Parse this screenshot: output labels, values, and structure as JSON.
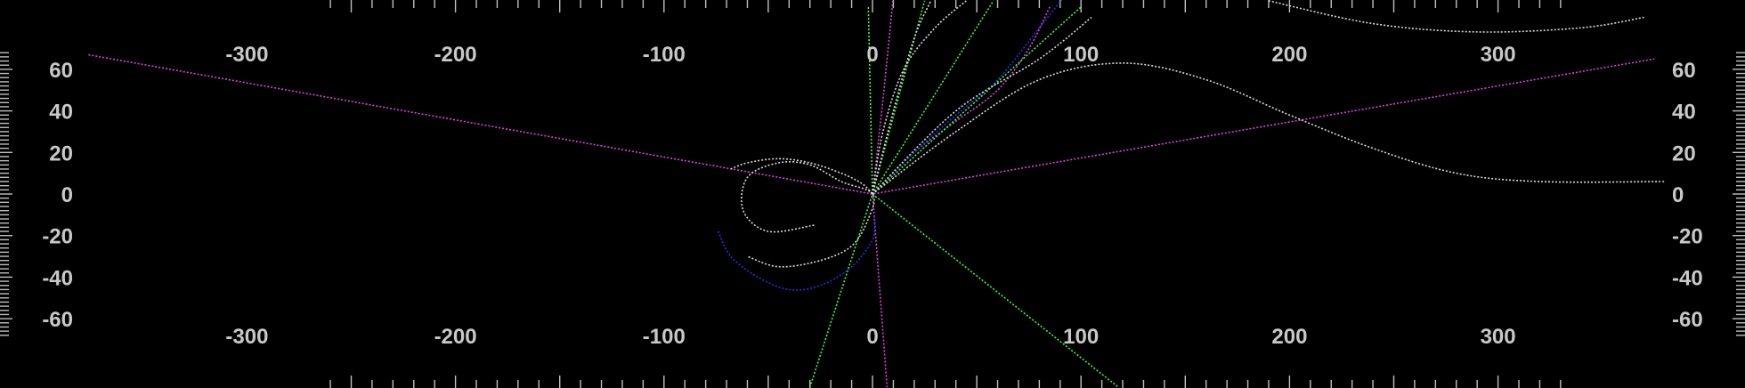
{
  "chart_data": {
    "type": "line",
    "title": "",
    "xlabel": "",
    "ylabel": "",
    "xlim": [
      -420,
      420
    ],
    "ylim": [
      -93,
      93
    ],
    "grid": false,
    "x_ticks": [
      {
        "value": -300,
        "label": "-300"
      },
      {
        "value": -200,
        "label": "-200"
      },
      {
        "value": -100,
        "label": "-100"
      },
      {
        "value": 0,
        "label": "0"
      },
      {
        "value": 100,
        "label": "100"
      },
      {
        "value": 200,
        "label": "200"
      },
      {
        "value": 300,
        "label": "300"
      }
    ],
    "y_ticks": [
      {
        "value": 60,
        "label": "60"
      },
      {
        "value": 40,
        "label": "40"
      },
      {
        "value": 20,
        "label": "20"
      },
      {
        "value": 0,
        "label": "0"
      },
      {
        "value": -20,
        "label": "-20"
      },
      {
        "value": -40,
        "label": "-40"
      },
      {
        "value": -60,
        "label": "-60"
      }
    ],
    "minor_tick_step_x": 10,
    "minor_tick_step_y": 2,
    "colors": {
      "background": "#000000",
      "axis_text": "#c8c8c8",
      "white": "#d8d8d8",
      "green": "#33ff33",
      "magenta": "#e040e0",
      "blue": "#2233dd"
    },
    "series": [
      {
        "color": "magenta",
        "points": [
          [
            -376,
            67
          ],
          [
            0,
            0
          ],
          [
            375,
            65
          ]
        ]
      },
      {
        "color": "magenta",
        "points": [
          [
            0,
            0
          ],
          [
            5,
            45
          ],
          [
            10,
            95
          ]
        ]
      },
      {
        "color": "magenta",
        "points": [
          [
            0,
            0
          ],
          [
            7,
            -93
          ]
        ]
      },
      {
        "color": "magenta",
        "points": [
          [
            0,
            0
          ],
          [
            20,
            20
          ],
          [
            40,
            35
          ],
          [
            60,
            50
          ],
          [
            75,
            70
          ],
          [
            85,
            90
          ]
        ]
      },
      {
        "color": "green",
        "points": [
          [
            -30,
            -93
          ],
          [
            0,
            0
          ],
          [
            25,
            93
          ]
        ]
      },
      {
        "color": "green",
        "points": [
          [
            0,
            0
          ],
          [
            58,
            93
          ]
        ]
      },
      {
        "color": "green",
        "points": [
          [
            0,
            0
          ],
          [
            100,
            90
          ]
        ]
      },
      {
        "color": "green",
        "points": [
          [
            0,
            0
          ],
          [
            118,
            -93
          ]
        ]
      },
      {
        "color": "green",
        "points": [
          [
            0,
            0
          ],
          [
            -2,
            90
          ]
        ]
      },
      {
        "color": "blue",
        "points": [
          [
            0,
            0
          ],
          [
            20,
            20
          ],
          [
            40,
            38
          ],
          [
            60,
            55
          ],
          [
            80,
            80
          ],
          [
            92,
            95
          ]
        ]
      },
      {
        "color": "blue",
        "points": [
          [
            -74,
            -18
          ],
          [
            -68,
            -30
          ],
          [
            -55,
            -40
          ],
          [
            -40,
            -46
          ],
          [
            -25,
            -44
          ],
          [
            -10,
            -35
          ],
          [
            0,
            -22
          ],
          [
            1,
            -10
          ]
        ]
      },
      {
        "color": "white",
        "points": [
          [
            -68,
            12
          ],
          [
            -60,
            15
          ],
          [
            -45,
            17
          ],
          [
            -30,
            15
          ],
          [
            -15,
            10
          ],
          [
            -5,
            5
          ],
          [
            0,
            0
          ]
        ]
      },
      {
        "color": "white",
        "points": [
          [
            -28,
            -15
          ],
          [
            -50,
            -18
          ],
          [
            -62,
            -8
          ],
          [
            -60,
            8
          ],
          [
            -45,
            15
          ],
          [
            -30,
            14
          ],
          [
            -15,
            6
          ],
          [
            0,
            0
          ],
          [
            -2,
            -12
          ],
          [
            -10,
            -25
          ],
          [
            -25,
            -32
          ],
          [
            -45,
            -35
          ],
          [
            -60,
            -30
          ]
        ]
      },
      {
        "color": "white",
        "points": [
          [
            0,
            0
          ],
          [
            40,
            30
          ],
          [
            80,
            55
          ],
          [
            120,
            63
          ],
          [
            160,
            55
          ],
          [
            200,
            38
          ],
          [
            240,
            22
          ],
          [
            280,
            10
          ],
          [
            320,
            6
          ],
          [
            380,
            6
          ]
        ]
      },
      {
        "color": "white",
        "points": [
          [
            0,
            0
          ],
          [
            5,
            30
          ],
          [
            15,
            60
          ],
          [
            30,
            80
          ],
          [
            45,
            93
          ]
        ]
      },
      {
        "color": "white",
        "points": [
          [
            0,
            0
          ],
          [
            10,
            40
          ],
          [
            20,
            75
          ],
          [
            28,
            93
          ]
        ]
      },
      {
        "color": "white",
        "points": [
          [
            190,
            93
          ],
          [
            240,
            82
          ],
          [
            290,
            78
          ],
          [
            340,
            80
          ],
          [
            370,
            85
          ]
        ]
      },
      {
        "color": "white",
        "points": [
          [
            0,
            0
          ],
          [
            40,
            40
          ],
          [
            80,
            65
          ],
          [
            105,
            85
          ]
        ]
      }
    ]
  }
}
